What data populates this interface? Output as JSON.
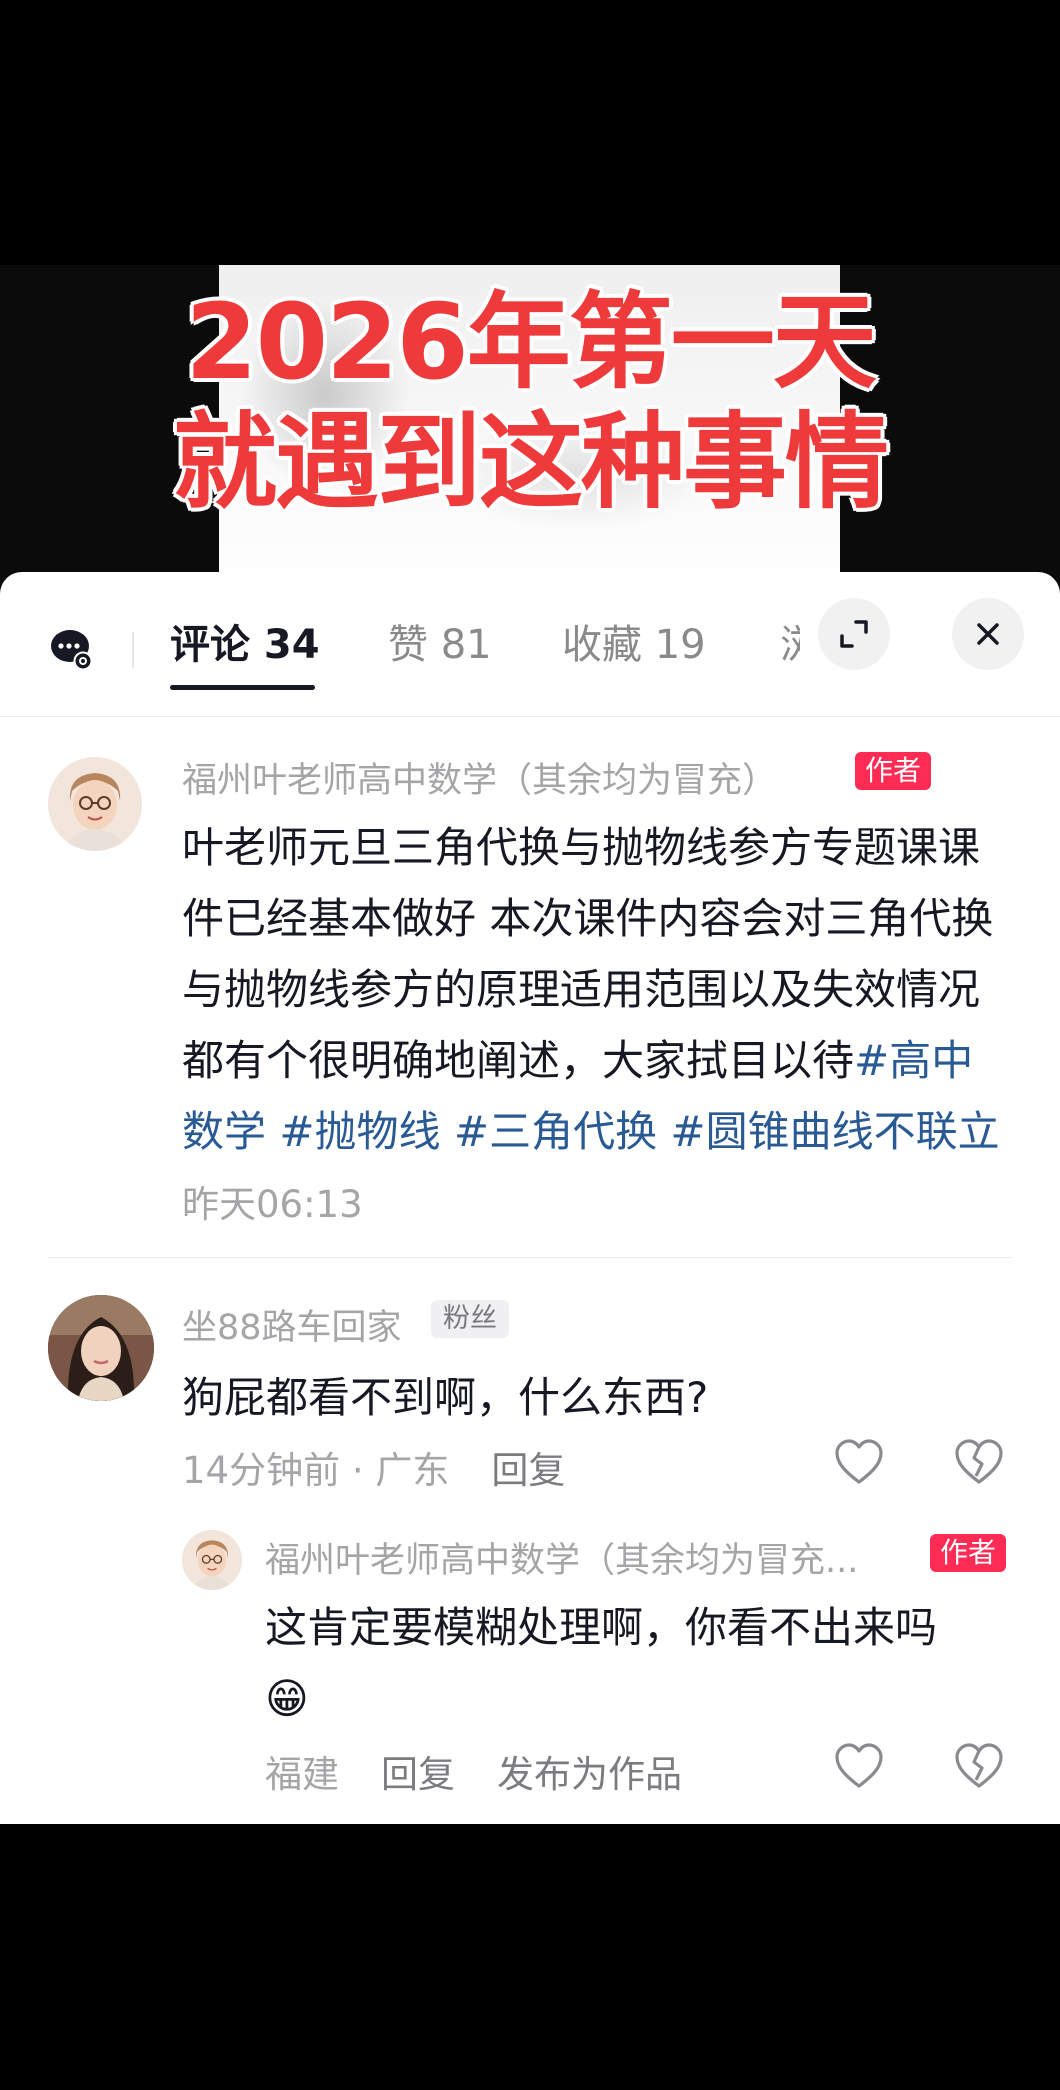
{
  "video": {
    "headline_line1": "2026年第一天",
    "headline_line2": "就遇到这种事情"
  },
  "tabs": [
    {
      "label": "评论 34",
      "active": true
    },
    {
      "label": "赞 81",
      "active": false
    },
    {
      "label": "收藏 19",
      "active": false
    },
    {
      "label": "浏",
      "active": false
    }
  ],
  "icons": {
    "message": "chat-bubble-icon",
    "expand": "expand-icon",
    "close": "close-icon",
    "like": "heart-icon",
    "dislike": "broken-heart-icon"
  },
  "colors": {
    "author_badge": "#fe2c55",
    "hashtag": "#2a5a93",
    "headline": "#ee3a3a"
  },
  "comments": [
    {
      "author": "福州叶老师高中数学（其余均为冒充）",
      "badge": "作者",
      "text": "叶老师元旦三角代换与抛物线参方专题课课件已经基本做好 本次课件内容会对三角代换与抛物线参方的原理适用范围以及失效情况都有个很明确地阐述，大家拭目以待",
      "hashtags": "#高中数学 #抛物线 #三角代换 #圆锥曲线不联立",
      "time": "昨天06:13"
    },
    {
      "author": "坐88路车回家",
      "badge": "粉丝",
      "text": "狗屁都看不到啊，什么东西?",
      "meta": "14分钟前 · 广东",
      "reply_label": "回复",
      "replies": [
        {
          "author": "福州叶老师高中数学（其余均为冒充...",
          "badge": "作者",
          "text": "这肯定要模糊处理啊，你看不出来吗",
          "emoji": "😁",
          "location": "福建",
          "reply_label": "回复",
          "publish_label": "发布为作品"
        }
      ]
    }
  ]
}
